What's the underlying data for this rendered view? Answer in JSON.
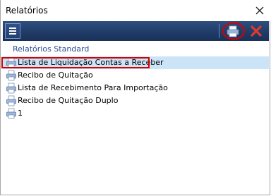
{
  "window": {
    "title": "Relatórios"
  },
  "icons": {
    "close": "close-icon",
    "menu": "hamburger-menu-icon",
    "print": "print-report-icon",
    "cancel": "red-x-icon",
    "report": "report-printer-icon"
  },
  "colors": {
    "toolbar": "#1f3a66",
    "group_header": "#2b4f8f",
    "selection": "#cce4f7",
    "highlight": "#d80000",
    "cancel": "#e03a2e"
  },
  "group": {
    "label": "Relatórios Standard"
  },
  "reports": [
    {
      "label": "Lista de Liquidação Contas a Receber"
    },
    {
      "label": "Recibo de Quitação"
    },
    {
      "label": "Lista de Recebimento Para Importação"
    },
    {
      "label": "Recibo de Quitação Duplo"
    },
    {
      "label": "1"
    }
  ]
}
